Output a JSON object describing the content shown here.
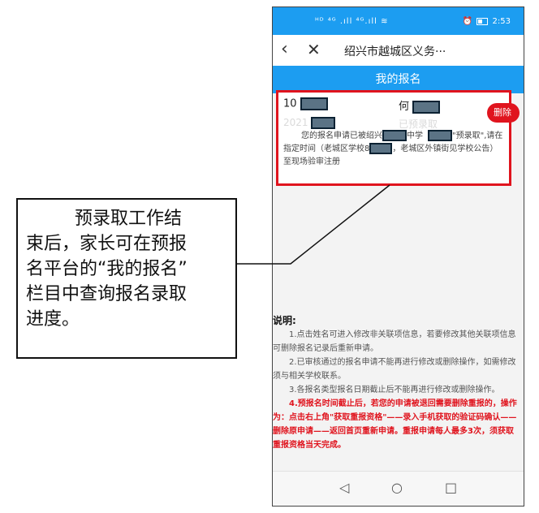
{
  "status_bar": {
    "left": "ᴴᴰ ⁴ᴳ .ıll ⁴ᴳ.ıll ≋",
    "alarm": "⏰",
    "time": "2:53"
  },
  "navbar": {
    "back_icon": "‹",
    "close_icon": "✕",
    "title": "绍兴市越城区义务···"
  },
  "page_header": {
    "title": "我的报名"
  },
  "card": {
    "id_prefix": "10",
    "name_prefix": "何",
    "year_prefix": "2021",
    "status": "已预录取",
    "msg_part1": "您的报名申请已被绍兴",
    "msg_part2": "中学",
    "msg_part3": "\"预录取\",请在指定时间（老城区学校8",
    "msg_part4": "，老城区外镇街见学校公告）至现场验审注册",
    "delete_label": "删除"
  },
  "notes": {
    "title": "说明:",
    "items": [
      "1.点击姓名可进入修改非关联项信息，若要修改其他关联项信息可删除报名记录后重新申请。",
      "2.已审核通过的报名申请不能再进行修改或删除操作，如需修改须与相关学校联系。",
      "3.各报名类型报名日期截止后不能再进行修改或删除操作。",
      "4.预报名时间截止后，若您的申请被退回需要删除重报的，操作为：点击右上角\"获取重报资格\"——录入手机获取的验证码确认——删除原申请——返回首页重新申请。重报申请每人最多3次，须获取重报资格当天完成。"
    ]
  },
  "bottom_nav": {
    "back": "◁",
    "home": "○",
    "recent": "□"
  },
  "callout": {
    "lines": [
      "预录取工作结",
      "束后，家长可在预报",
      "名平台的“我的报名”",
      "栏目中查询报名录取",
      "进度。"
    ]
  },
  "colors": {
    "accent": "#1c9df1",
    "highlight": "#e0141e"
  }
}
